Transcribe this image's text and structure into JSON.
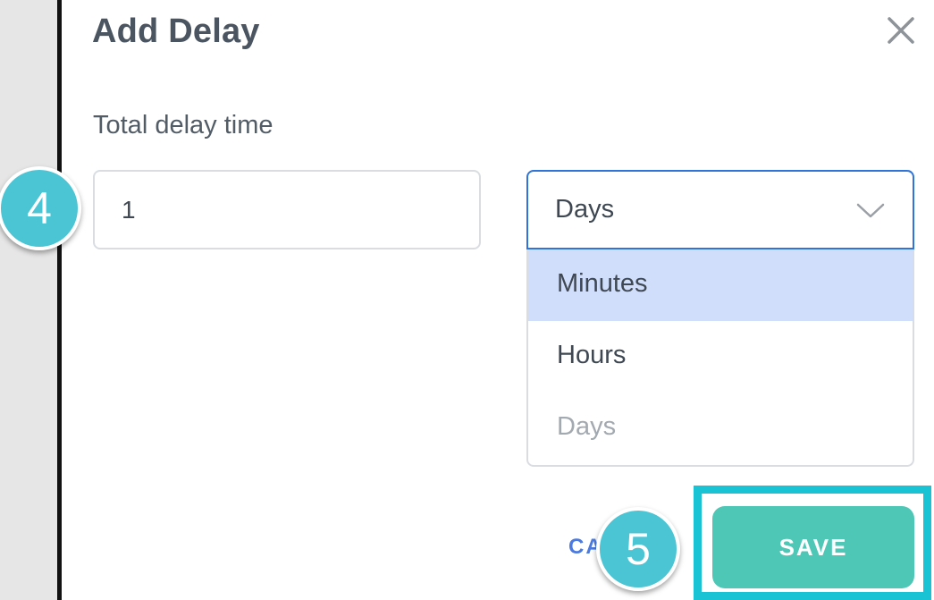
{
  "dialog": {
    "title": "Add Delay",
    "close_icon": "close-icon"
  },
  "form": {
    "label": "Total delay time",
    "delay_value": "1",
    "unit_select": {
      "selected": "Days",
      "chevron_icon": "chevron-down-icon",
      "options": [
        {
          "label": "Minutes",
          "state": "hovered"
        },
        {
          "label": "Hours",
          "state": "normal"
        },
        {
          "label": "Days",
          "state": "selected"
        }
      ]
    }
  },
  "actions": {
    "cancel_label": "CA",
    "save_label": "SAVE"
  },
  "annotations": {
    "step_input": "4",
    "step_save": "5"
  },
  "colors": {
    "accent_blue": "#2f74d8",
    "highlight_option": "#d0defb",
    "save_button": "#4ec7b6",
    "annotation_teal": "#19c3d4",
    "badge": "#4bc4d4"
  }
}
